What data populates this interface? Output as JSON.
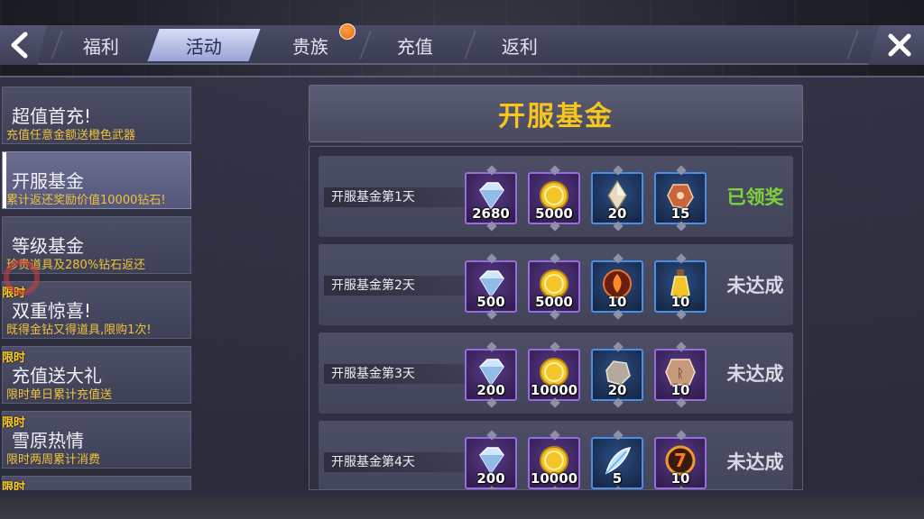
{
  "topbar": {
    "tabs": [
      {
        "label": "福利",
        "active": false
      },
      {
        "label": "活动",
        "active": true
      },
      {
        "label": "贵族",
        "active": false,
        "has_notification": true
      },
      {
        "label": "充值",
        "active": false
      },
      {
        "label": "返利",
        "active": false
      }
    ]
  },
  "sidebar": {
    "items": [
      {
        "title": "超值首充!",
        "subtitle": "充值任意金额送橙色武器",
        "limited": false,
        "active": false
      },
      {
        "title": "开服基金",
        "subtitle": "累计返还奖励价值10000钻石!",
        "limited": false,
        "active": true
      },
      {
        "title": "等级基金",
        "subtitle": "珍贵道具及280%钻石返还",
        "limited": false,
        "active": false
      },
      {
        "title": "双重惊喜!",
        "subtitle": "既得金钻又得道具,限购1次!",
        "limited": true,
        "active": false
      },
      {
        "title": "充值送大礼",
        "subtitle": "限时单日累计充值送",
        "limited": true,
        "active": false
      },
      {
        "title": "雪原热情",
        "subtitle": "限时两周累计消费",
        "limited": true,
        "active": false
      }
    ],
    "limited_label": "限时"
  },
  "panel": {
    "title": "开服基金",
    "rows": [
      {
        "label": "开服基金第1天",
        "status": "已领奖",
        "claimed": true,
        "rewards": [
          {
            "icon": "diamond-icon",
            "qty": "2680",
            "frame": "purple"
          },
          {
            "icon": "gold-coin-icon",
            "qty": "5000",
            "frame": "purple"
          },
          {
            "icon": "crystal-shard-icon",
            "qty": "20",
            "frame": "blue"
          },
          {
            "icon": "orange-ore-icon",
            "qty": "15",
            "frame": "blue"
          }
        ]
      },
      {
        "label": "开服基金第2天",
        "status": "未达成",
        "claimed": false,
        "rewards": [
          {
            "icon": "diamond-icon",
            "qty": "500",
            "frame": "purple"
          },
          {
            "icon": "gold-coin-icon",
            "qty": "5000",
            "frame": "purple"
          },
          {
            "icon": "fire-emblem-icon",
            "qty": "10",
            "frame": "blue"
          },
          {
            "icon": "potion-bottle-icon",
            "qty": "10",
            "frame": "blue"
          }
        ]
      },
      {
        "label": "开服基金第3天",
        "status": "未达成",
        "claimed": false,
        "rewards": [
          {
            "icon": "diamond-icon",
            "qty": "200",
            "frame": "purple"
          },
          {
            "icon": "gold-coin-icon",
            "qty": "10000",
            "frame": "purple"
          },
          {
            "icon": "stone-icon",
            "qty": "20",
            "frame": "blue"
          },
          {
            "icon": "rune-stone-icon",
            "qty": "10",
            "frame": "purple"
          }
        ]
      },
      {
        "label": "开服基金第4天",
        "status": "未达成",
        "claimed": false,
        "rewards": [
          {
            "icon": "diamond-icon",
            "qty": "200",
            "frame": "purple"
          },
          {
            "icon": "gold-coin-icon",
            "qty": "10000",
            "frame": "purple"
          },
          {
            "icon": "feather-icon",
            "qty": "5",
            "frame": "blue"
          },
          {
            "icon": "lucky-seven-icon",
            "qty": "10",
            "frame": "purple"
          }
        ]
      }
    ]
  },
  "colors": {
    "title_gold": "#f7c51e",
    "subtitle_gold": "#f2c23b",
    "claimed_green": "#7ed13a",
    "notification_orange": "#f07a1a"
  }
}
